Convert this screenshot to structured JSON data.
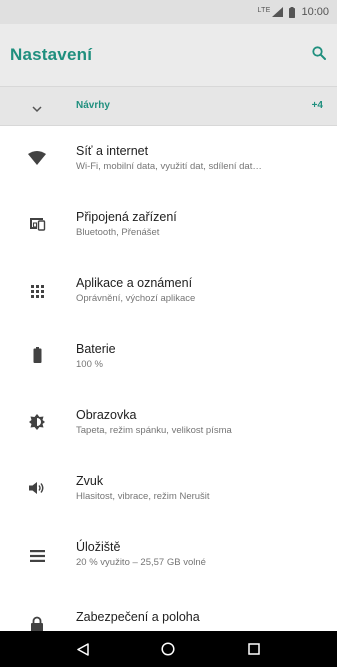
{
  "status_bar": {
    "network": "LTE",
    "time": "10:00"
  },
  "app_bar": {
    "title": "Nastavení"
  },
  "suggestions": {
    "label": "Návrhy",
    "count": "+4"
  },
  "items": [
    {
      "title": "Síť a internet",
      "subtitle": "Wi-Fi, mobilní data, využití dat, sdílení dat…",
      "icon": "wifi-icon"
    },
    {
      "title": "Připojená zařízení",
      "subtitle": "Bluetooth, Přenášet",
      "icon": "devices-icon"
    },
    {
      "title": "Aplikace a oznámení",
      "subtitle": "Oprávnění, výchozí aplikace",
      "icon": "apps-grid-icon"
    },
    {
      "title": "Baterie",
      "subtitle": "100 %",
      "icon": "battery-icon"
    },
    {
      "title": "Obrazovka",
      "subtitle": "Tapeta, režim spánku, velikost písma",
      "icon": "brightness-icon"
    },
    {
      "title": "Zvuk",
      "subtitle": "Hlasitost, vibrace, režim Nerušit",
      "icon": "volume-icon"
    },
    {
      "title": "Úložiště",
      "subtitle": "20 % využito – 25,57 GB volné",
      "icon": "storage-icon"
    },
    {
      "title": "Zabezpečení a poloha",
      "subtitle": "",
      "icon": "lock-icon"
    }
  ],
  "colors": {
    "accent": "#1f8f7e",
    "icon": "#424242"
  }
}
